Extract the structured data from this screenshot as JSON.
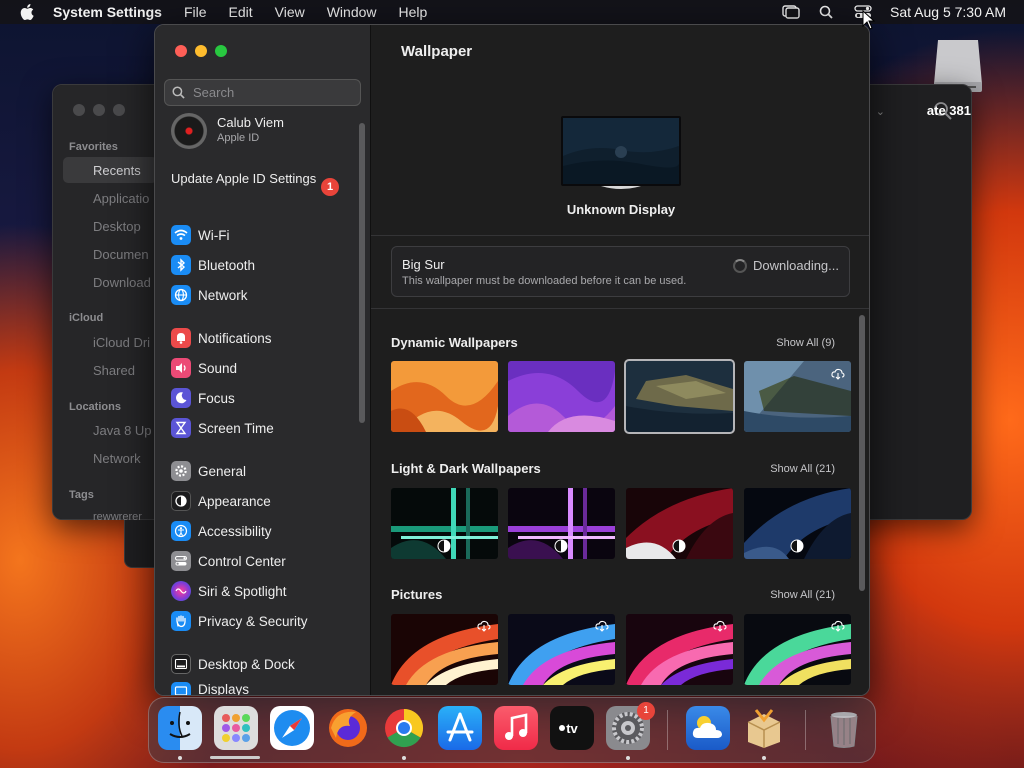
{
  "menubar": {
    "app": "System Settings",
    "items": [
      "File",
      "Edit",
      "View",
      "Window",
      "Help"
    ],
    "datetime": "Sat Aug 5  7:30 AM"
  },
  "finder": {
    "sections": {
      "favorites": "Favorites",
      "icloud": "iCloud",
      "locations": "Locations",
      "tags": "Tags"
    },
    "items": {
      "recents": "Recents",
      "applications": "Applicatio",
      "desktop": "Desktop",
      "documents": "Documen",
      "downloads": "Download",
      "icloud_drive": "iCloud Dri",
      "shared": "Shared",
      "java": "Java 8 Up",
      "network": "Network",
      "tag": "rewwrerer"
    },
    "title_fragment": "ate 381"
  },
  "sidebar": {
    "search_placeholder": "Search",
    "account": {
      "name": "Calub Viem",
      "subtitle": "Apple ID"
    },
    "update": {
      "label": "Update Apple ID Settings",
      "badge": "1"
    },
    "items": [
      {
        "label": "Wi-Fi",
        "icon": "wifi-icon",
        "color": "#1a8cf5"
      },
      {
        "label": "Bluetooth",
        "icon": "bluetooth-icon",
        "color": "#1a8cf5"
      },
      {
        "label": "Network",
        "icon": "globe-icon",
        "color": "#1a8cf5"
      },
      {
        "label": "Notifications",
        "icon": "bell-icon",
        "color": "#ec4a4a"
      },
      {
        "label": "Sound",
        "icon": "speaker-icon",
        "color": "#ec4a76"
      },
      {
        "label": "Focus",
        "icon": "moon-icon",
        "color": "#5b55d6"
      },
      {
        "label": "Screen Time",
        "icon": "hourglass-icon",
        "color": "#5b55d6"
      },
      {
        "label": "General",
        "icon": "gear-icon",
        "color": "#8e8e92"
      },
      {
        "label": "Appearance",
        "icon": "appearance-icon",
        "color": "#1c1c1e"
      },
      {
        "label": "Accessibility",
        "icon": "accessibility-icon",
        "color": "#1a8cf5"
      },
      {
        "label": "Control Center",
        "icon": "toggles-icon",
        "color": "#8e8e92"
      },
      {
        "label": "Siri & Spotlight",
        "icon": "siri-icon",
        "color": "#a03ed8"
      },
      {
        "label": "Privacy & Security",
        "icon": "hand-icon",
        "color": "#1a8cf5"
      },
      {
        "label": "Desktop & Dock",
        "icon": "dock-icon",
        "color": "#1c1c1e"
      },
      {
        "label": "Displays",
        "icon": "display-icon",
        "color": "#1a8cf5"
      }
    ]
  },
  "content": {
    "title": "Wallpaper",
    "display_name": "Unknown Display",
    "download": {
      "title": "Big Sur",
      "subtitle": "This wallpaper must be downloaded before it can be used.",
      "status": "Downloading..."
    },
    "sections": [
      {
        "title": "Dynamic Wallpapers",
        "show_all": "Show All (9)"
      },
      {
        "title": "Light & Dark Wallpapers",
        "show_all": "Show All (21)"
      },
      {
        "title": "Pictures",
        "show_all": "Show All (21)"
      }
    ]
  },
  "dock": {
    "apps": [
      "Finder",
      "Launchpad",
      "Safari",
      "Firefox",
      "Chrome",
      "App Store",
      "Music",
      "TV",
      "System Settings",
      "Weather",
      "Installer",
      "Trash"
    ],
    "settings_badge": "1"
  }
}
